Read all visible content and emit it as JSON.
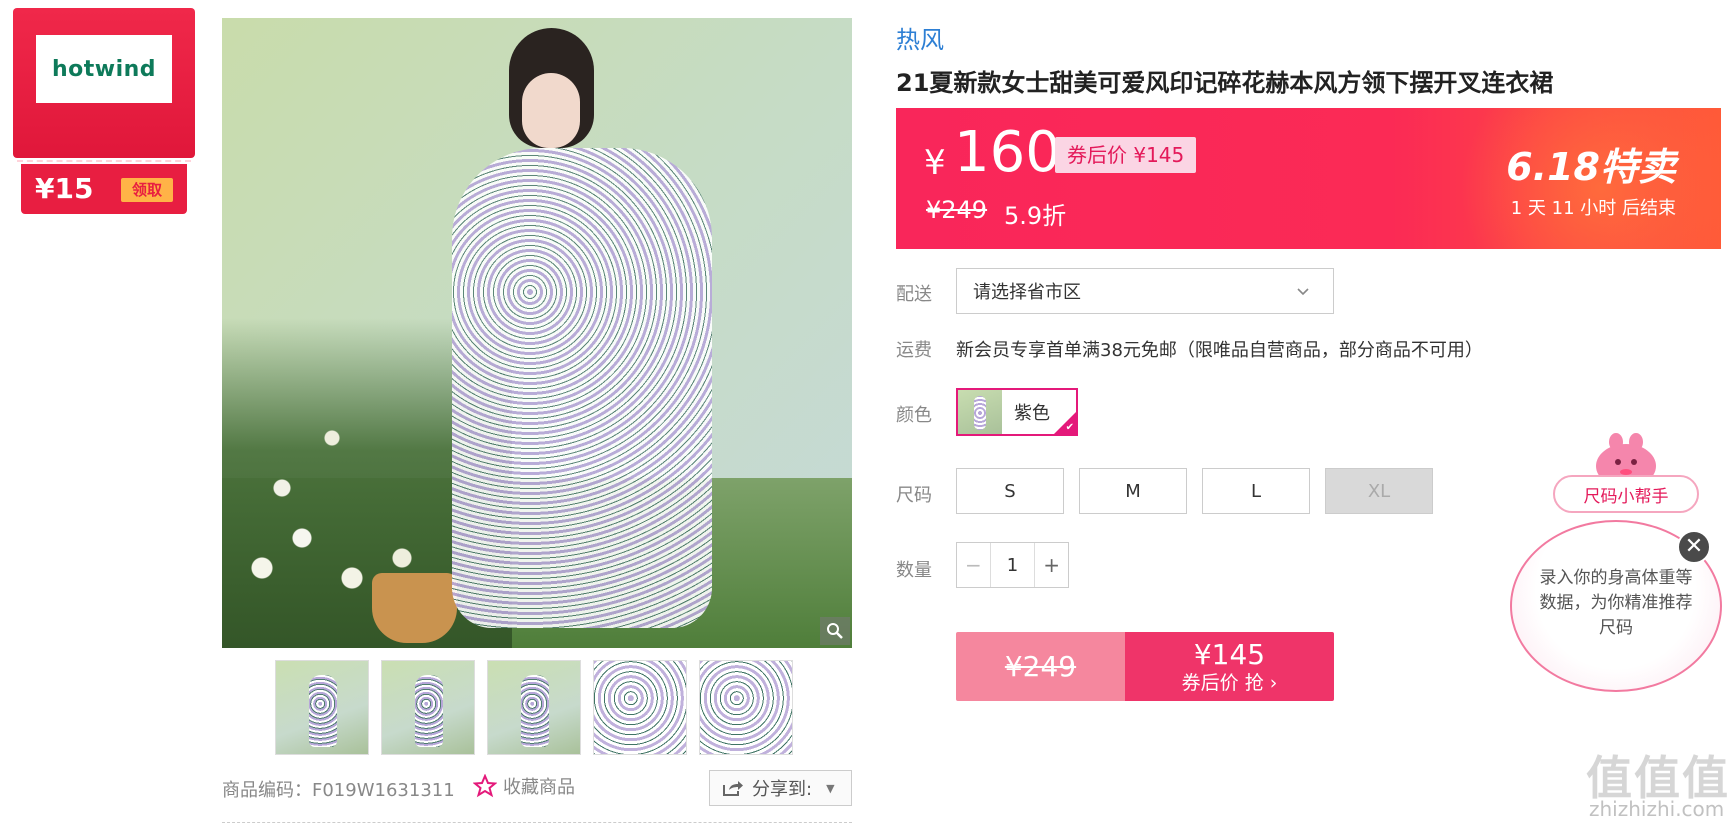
{
  "coupon": {
    "brand_logo_text": "hotwind",
    "amount": "¥15",
    "claim_label": "领取"
  },
  "product": {
    "brand": "热风",
    "title": "21夏新款女士甜美可爱风印记碎花赫本风方领下摆开叉连衣裙",
    "code_label": "商品编码：F019W1631311",
    "favorite_label": "收藏商品",
    "share_label": "分享到:"
  },
  "price": {
    "yen": "¥",
    "current": "160",
    "coupon_price": "券后价 ¥145",
    "original": "¥249",
    "discount": "5.9折",
    "promo_badge": "6.18特卖",
    "countdown": "1 天 11 小时 后结束"
  },
  "delivery": {
    "label": "配送",
    "placeholder": "请选择省市区"
  },
  "shipping": {
    "label": "运费",
    "text": "新会员专享首单满38元免邮（限唯品自营商品，部分商品不可用）"
  },
  "color": {
    "label": "颜色",
    "selected": "紫色"
  },
  "size": {
    "label": "尺码",
    "options": [
      "S",
      "M",
      "L",
      "XL"
    ],
    "disabled": [
      "XL"
    ]
  },
  "quantity": {
    "label": "数量",
    "value": "1",
    "minus": "−",
    "plus": "+"
  },
  "buy": {
    "original": "¥249",
    "price": "¥145",
    "label": "券后价 抢 ›"
  },
  "size_helper": {
    "tag": "尺码小帮手",
    "text": "录入你的身高体重等数据，为你精准推荐尺码",
    "close": "✕"
  },
  "watermark": {
    "logo": "值值值",
    "url": "zhizhizhi.com"
  },
  "colors": {
    "accent": "#f9265a",
    "brand_link": "#2d7fd4",
    "selected_border": "#e4197a"
  }
}
